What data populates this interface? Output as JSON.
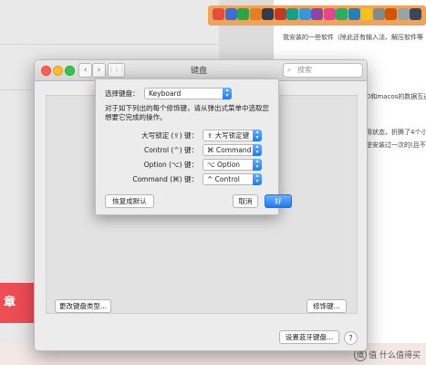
{
  "background": {
    "red_label": "章",
    "text_lines": [
      "我安装的一些软件（除此还有输入法、解压软件等",
      "D和macos的数据互通",
      "用状态，折腾了4个小",
      "是安装过一次的(且不"
    ],
    "watermark": "值 什么值得买",
    "dock_colors": [
      "#e74c3c",
      "#3b6ed8",
      "#28a745",
      "#e67e22",
      "#2c3e50",
      "#c0392b",
      "#16a085",
      "#3498db",
      "#8e44ad",
      "#e84393",
      "#27ae60",
      "#2980b9",
      "#f1c40f",
      "#7f8c8d",
      "#d35400",
      "#95a5a6",
      "#34495e"
    ]
  },
  "window": {
    "title": "键盘",
    "nav_back": "‹",
    "nav_forward": "›",
    "grid_icon": "⋮⋮⋮",
    "search_placeholder": "搜索",
    "change_keyboard_type_label": "更改键盘类型...",
    "modifier_keys_label": "修饰键...",
    "setup_bluetooth_label": "设置蓝牙键盘...",
    "help_label": "?"
  },
  "sheet": {
    "select_keyboard_label": "选择键盘：",
    "select_keyboard_value": "Keyboard",
    "description": "对于如下列出的每个修饰键，请从弹出式菜单中选取您想要它完成的操作。",
    "rows": [
      {
        "label": "大写锁定 (⇪) 键：",
        "value": "⇪ 大写锁定键"
      },
      {
        "label": "Control (^) 键：",
        "value": "⌘ Command"
      },
      {
        "label": "Option (⌥) 键：",
        "value": "⌥ Option"
      },
      {
        "label": "Command (⌘) 键：",
        "value": "^ Control"
      }
    ],
    "restore_defaults_label": "恢复成默认",
    "cancel_label": "取消",
    "ok_label": "好"
  }
}
